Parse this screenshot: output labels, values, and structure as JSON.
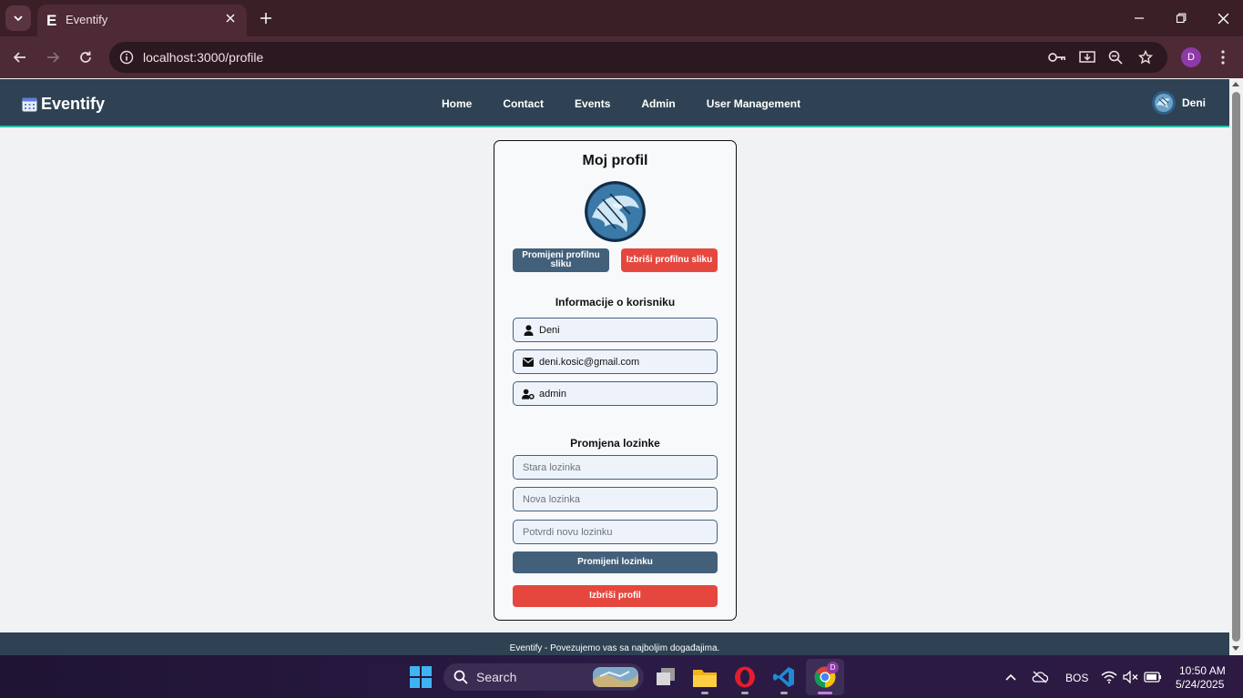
{
  "browser": {
    "tab_title": "Eventify",
    "tab_favicon": "E",
    "url": "localhost:3000/profile",
    "profile_initial": "D"
  },
  "navbar": {
    "brand": "Eventify",
    "links": [
      "Home",
      "Contact",
      "Events",
      "Admin",
      "User Management"
    ],
    "username": "Deni"
  },
  "profile": {
    "title": "Moj profil",
    "change_pic_label": "Promijeni profilnu sliku",
    "delete_pic_label": "Izbriši profilnu sliku",
    "info_title": "Informacije o korisniku",
    "username": "Deni",
    "email": "deni.kosic@gmail.com",
    "role": "admin",
    "password_title": "Promjena lozinke",
    "old_password_placeholder": "Stara lozinka",
    "new_password_placeholder": "Nova lozinka",
    "confirm_password_placeholder": "Potvrdi novu lozinku",
    "change_password_label": "Promijeni lozinku",
    "delete_profile_label": "Izbriši profil"
  },
  "footer": {
    "text": "Eventify - Povezujemo vas sa najboljim događajima."
  },
  "taskbar": {
    "search_label": "Search",
    "chrome_badge": "D",
    "language": "BOS",
    "time": "10:50 AM",
    "date": "5/24/2025"
  },
  "colors": {
    "navbar": "#2e4253",
    "accent_teal": "#23c3a6",
    "button_slate": "#43607a",
    "button_red": "#e5473f",
    "browser_frame": "#3a1f27"
  }
}
